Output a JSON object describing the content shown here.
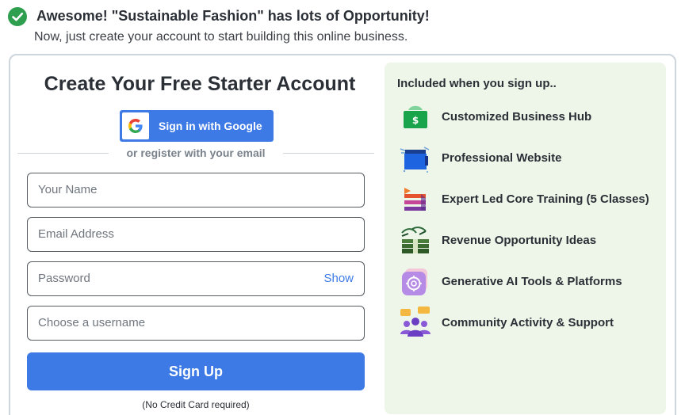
{
  "banner": {
    "title": "Awesome! \"Sustainable Fashion\" has lots of Opportunity!",
    "subtitle": "Now, just create your account to start building this online business."
  },
  "form": {
    "title": "Create Your Free Starter Account",
    "google_button": "Sign in with Google",
    "divider_text": "or register with your email",
    "name_placeholder": "Your Name",
    "email_placeholder": "Email Address",
    "password_placeholder": "Password",
    "password_toggle": "Show",
    "username_placeholder": "Choose a username",
    "submit_label": "Sign Up",
    "note": "(No Credit Card required)"
  },
  "perks": {
    "title": "Included when you sign up..",
    "items": [
      {
        "label": "Customized Business Hub",
        "icon": "money-hub-icon"
      },
      {
        "label": "Professional Website",
        "icon": "website-icon"
      },
      {
        "label": "Expert Led Core Training (5 Classes)",
        "icon": "training-icon"
      },
      {
        "label": "Revenue Opportunity Ideas",
        "icon": "revenue-icon"
      },
      {
        "label": "Generative AI Tools & Platforms",
        "icon": "ai-tools-icon"
      },
      {
        "label": "Community Activity & Support",
        "icon": "community-icon"
      }
    ]
  },
  "colors": {
    "accent": "#3d7ae6",
    "success": "#2e9e4f",
    "perks_background": "#eef6ea"
  }
}
